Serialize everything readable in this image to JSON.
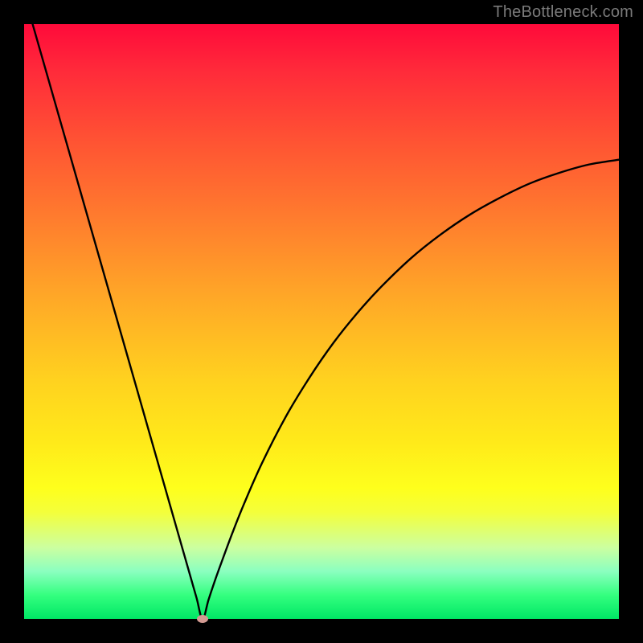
{
  "watermark": "TheBottleneck.com",
  "chart_data": {
    "type": "line",
    "title": "",
    "xlabel": "",
    "ylabel": "",
    "xlim": [
      0,
      100
    ],
    "ylim": [
      0,
      100
    ],
    "x": [
      0,
      4,
      8,
      12,
      16,
      18,
      20,
      22,
      24,
      26,
      27,
      28,
      29,
      30,
      31,
      32,
      33,
      35,
      37,
      40,
      44,
      48,
      52,
      56,
      60,
      65,
      70,
      75,
      80,
      85,
      90,
      95,
      100
    ],
    "values": [
      105,
      91,
      77,
      63,
      49,
      42,
      35,
      28,
      21,
      14,
      10.5,
      7,
      3.5,
      0,
      3.2,
      6.2,
      9,
      14.4,
      19.4,
      26.2,
      34,
      40.6,
      46.4,
      51.4,
      55.8,
      60.6,
      64.6,
      68,
      70.8,
      73.2,
      75,
      76.4,
      77.2
    ],
    "marker": {
      "x": 30,
      "y": 0,
      "color": "#d39a92",
      "shape": "ellipse"
    },
    "background_gradient": [
      "#ff0a3a",
      "#ffd21f",
      "#feff1c",
      "#00e765"
    ]
  }
}
